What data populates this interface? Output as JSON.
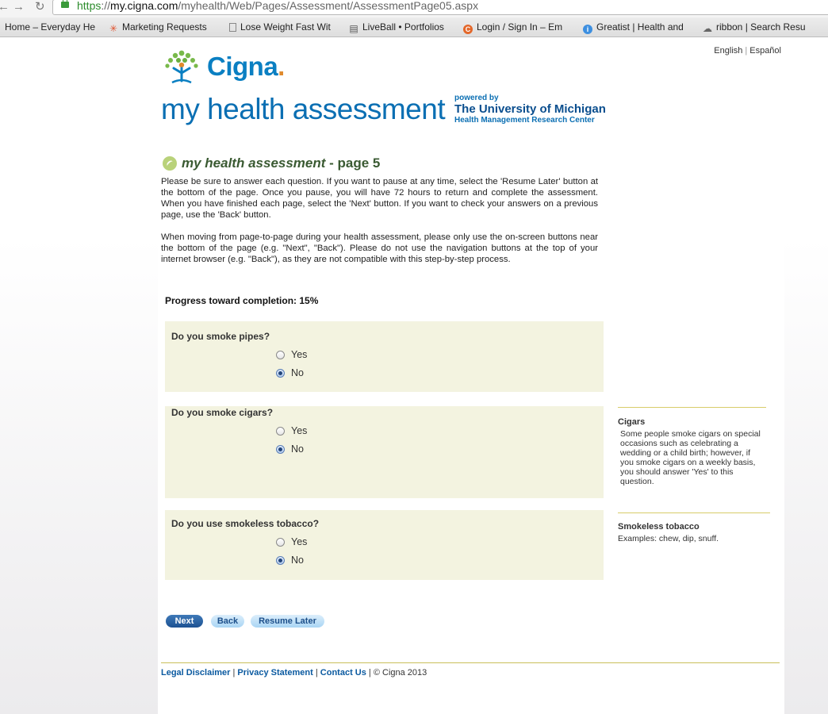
{
  "browser": {
    "url_scheme": "https",
    "url_sep": "://",
    "url_host": "my.cigna.com",
    "url_path": "/myhealth/Web/Pages/Assessment/AssessmentPage05.aspx",
    "bookmarks": [
      {
        "label": "Home – Everyday He",
        "icon": "text"
      },
      {
        "label": "Marketing Requests",
        "icon": "pinwheel-icon"
      },
      {
        "label": "Lose Weight Fast Wit",
        "icon": "page-icon"
      },
      {
        "label": "LiveBall • Portfolios",
        "icon": "doc-icon"
      },
      {
        "label": "Login / Sign In – Em",
        "icon": "c-circle-icon"
      },
      {
        "label": "Greatist | Health and",
        "icon": "info-circle-icon"
      },
      {
        "label": "ribbon | Search Resu",
        "icon": "cloud-icon"
      }
    ]
  },
  "lang": {
    "english": "English",
    "separator": "|",
    "espanol": "Español"
  },
  "brand": {
    "name": "Cigna",
    "dot": "."
  },
  "header": {
    "title": "my health assessment",
    "powered_by": "powered by",
    "university": "The University of Michigan",
    "center": "Health Management Research Center"
  },
  "page_title": {
    "italic": "my health assessment",
    "rest": " - page 5"
  },
  "intro": {
    "p1": "Please be sure to answer each question. If you want to pause at any time, select the 'Resume Later' button at the bottom of the page. Once you pause, you will have 72 hours to return and complete the assessment. When you have finished each page, select the 'Next' button. If you want to check your answers on a previous page, use the 'Back' button.",
    "p2": "When moving from page-to-page during your health assessment, please only use the on-screen buttons near the bottom of the page (e.g. \"Next\", \"Back\"). Please do not use the navigation buttons at the top of your internet browser (e.g. \"Back\"), as they are not compatible with this step-by-step process."
  },
  "progress": {
    "label": "Progress toward completion: 15%",
    "value": 15
  },
  "questions": [
    {
      "text": "Do you smoke pipes?",
      "options": [
        "Yes",
        "No"
      ],
      "selected": "No"
    },
    {
      "text": "Do you smoke cigars?",
      "options": [
        "Yes",
        "No"
      ],
      "selected": "No"
    },
    {
      "text": "Do you use smokeless tobacco?",
      "options": [
        "Yes",
        "No"
      ],
      "selected": "No"
    }
  ],
  "sidebar": [
    {
      "heading": "Cigars",
      "body": "Some people smoke cigars on special occasions such as celebrating a wedding or a child birth; however, if you smoke cigars on a weekly basis, you should answer 'Yes' to this question."
    },
    {
      "heading": "Smokeless tobacco",
      "body": "Examples: chew, dip, snuff."
    }
  ],
  "buttons": {
    "next": "Next",
    "back": "Back",
    "resume": "Resume Later"
  },
  "footer": {
    "legal": "Legal Disclaimer",
    "privacy": "Privacy Statement",
    "contact": "Contact Us",
    "sep": " | ",
    "copyright": "© Cigna 2013"
  },
  "colors": {
    "brand_blue": "#0a7fc2",
    "question_bg": "#f3f3e0",
    "rule_gold": "#d8cc6a"
  }
}
